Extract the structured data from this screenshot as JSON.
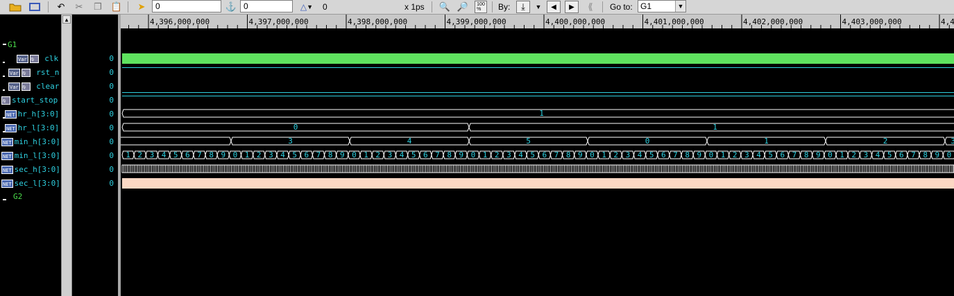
{
  "toolbar": {
    "cursor_time": "0",
    "marker_time": "0",
    "delta_value": "0",
    "time_unit": "x 1ps",
    "zoom_100_label": "100\n%",
    "by_label": "By:",
    "goto_label": "Go to:",
    "goto_value": "G1"
  },
  "ruler": {
    "labels": [
      "4,396,000,000",
      "4,397,000,000",
      "4,398,000,000",
      "4,399,000,000",
      "4,400,000,000",
      "4,401,000,000",
      "4,402,000,000",
      "4,403,000,000",
      "4,4"
    ]
  },
  "signals": {
    "group1": "G1",
    "clk": {
      "name": "clk",
      "tag": "Var",
      "value": "0"
    },
    "rst_n": {
      "name": "rst_n",
      "tag": "Var",
      "value": "0"
    },
    "clear": {
      "name": "clear",
      "tag": "Var",
      "value": "0"
    },
    "start_stop": {
      "name": "start_stop",
      "value": "0"
    },
    "hr_h": {
      "name": "hr_h[3:0]",
      "tag": "NET",
      "value": "0"
    },
    "hr_l": {
      "name": "hr_l[3:0]",
      "tag": "NET",
      "value": "0"
    },
    "min_h": {
      "name": "min_h[3:0]",
      "tag": "NET",
      "value": "0"
    },
    "min_l": {
      "name": "min_l[3:0]",
      "tag": "NET",
      "value": "0"
    },
    "sec_h": {
      "name": "sec_h[3:0]",
      "tag": "NET",
      "value": "0"
    },
    "sec_l": {
      "name": "sec_l[3:0]",
      "tag": "NET",
      "value": "0"
    },
    "group2": "G2"
  },
  "waves": {
    "hr_h_value": "1",
    "hr_l_values": [
      "0",
      "1"
    ],
    "min_h_values": [
      "3",
      "4",
      "5",
      "0",
      "1",
      "2",
      "3"
    ],
    "min_l_sequence": "1234567890123456789012345678901234567890123456789012345678901234567890"
  },
  "colors": {
    "clk_fill": "#5fe35f",
    "sec_l_fill": "#fcd8c4",
    "wire": "#2ed0e0",
    "bus": "#ffffff",
    "group": "#4bdc4b"
  }
}
